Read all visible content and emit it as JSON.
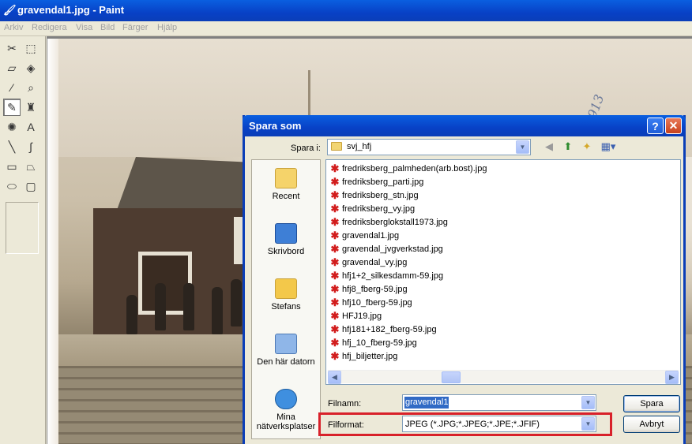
{
  "window": {
    "title": "gravendal1.jpg - Paint",
    "menu": [
      "Arkiv",
      "Redigera",
      "Visa",
      "Bild",
      "Färger",
      "Hjälp"
    ]
  },
  "toolbox": {
    "tools": [
      {
        "name": "free-form-select-icon",
        "glyph": "✂"
      },
      {
        "name": "rect-select-icon",
        "glyph": "⬚"
      },
      {
        "name": "eraser-icon",
        "glyph": "▱"
      },
      {
        "name": "fill-icon",
        "glyph": "◈"
      },
      {
        "name": "pick-color-icon",
        "glyph": "⁄"
      },
      {
        "name": "magnifier-icon",
        "glyph": "⌕"
      },
      {
        "name": "pencil-icon",
        "glyph": "✎"
      },
      {
        "name": "brush-icon",
        "glyph": "♜"
      },
      {
        "name": "airbrush-icon",
        "glyph": "✺"
      },
      {
        "name": "text-icon",
        "glyph": "A"
      },
      {
        "name": "line-icon",
        "glyph": "╲"
      },
      {
        "name": "curve-icon",
        "glyph": "∫"
      },
      {
        "name": "rectangle-icon",
        "glyph": "▭"
      },
      {
        "name": "polygon-icon",
        "glyph": "⏢"
      },
      {
        "name": "ellipse-icon",
        "glyph": "⬭"
      },
      {
        "name": "rounded-rect-icon",
        "glyph": "▢"
      }
    ]
  },
  "photo": {
    "script_text": "1913"
  },
  "dialog": {
    "title": "Spara som",
    "help_glyph": "?",
    "close_glyph": "✕",
    "save_in_label": "Spara i:",
    "save_in_value": "svj_hfj",
    "places": [
      {
        "label": "Recent",
        "color": "#f5d36a"
      },
      {
        "label": "Skrivbord",
        "color": "#3e7fd6"
      },
      {
        "label": "Stefans",
        "color": "#f3c84a"
      },
      {
        "label": "Den här datorn",
        "color": "#8fb6e8"
      },
      {
        "label": "Mina nätverksplatser",
        "color": "#3f8fdf"
      }
    ],
    "files": [
      "fredriksberg_palmheden(arb.bost).jpg",
      "fredriksberg_parti.jpg",
      "fredriksberg_stn.jpg",
      "fredriksberg_vy.jpg",
      "fredriksberglokstall1973.jpg",
      "gravendal1.jpg",
      "gravendal_jvgverkstad.jpg",
      "gravendal_vy.jpg",
      "hfj1+2_silkesdamm-59.jpg",
      "hfj8_fberg-59.jpg",
      "hfj10_fberg-59.jpg",
      "HFJ19.jpg",
      "hfj181+182_fberg-59.jpg",
      "hfj_10_fberg-59.jpg",
      "hfj_biljetter.jpg"
    ],
    "filename_label": "Filnamn:",
    "filename_value": "gravendal1",
    "format_label": "Filformat:",
    "format_value": "JPEG (*.JPG;*.JPEG;*.JPE;*.JFIF)",
    "save_button": "Spara",
    "cancel_button": "Avbryt",
    "highlight_color": "#d8212a"
  }
}
